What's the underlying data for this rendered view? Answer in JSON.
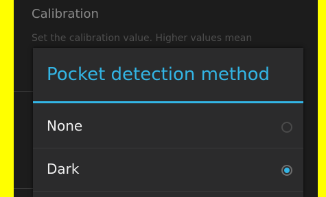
{
  "background": {
    "setting_title": "Calibration",
    "setting_summary": "Set the calibration value. Higher values mean"
  },
  "dialog": {
    "title": "Pocket detection method",
    "options": [
      {
        "label": "None",
        "selected": false
      },
      {
        "label": "Dark",
        "selected": true
      }
    ]
  },
  "colors": {
    "accent": "#33b5e5",
    "frame": "#ffff00",
    "dialog_bg": "#2b2b2c"
  }
}
